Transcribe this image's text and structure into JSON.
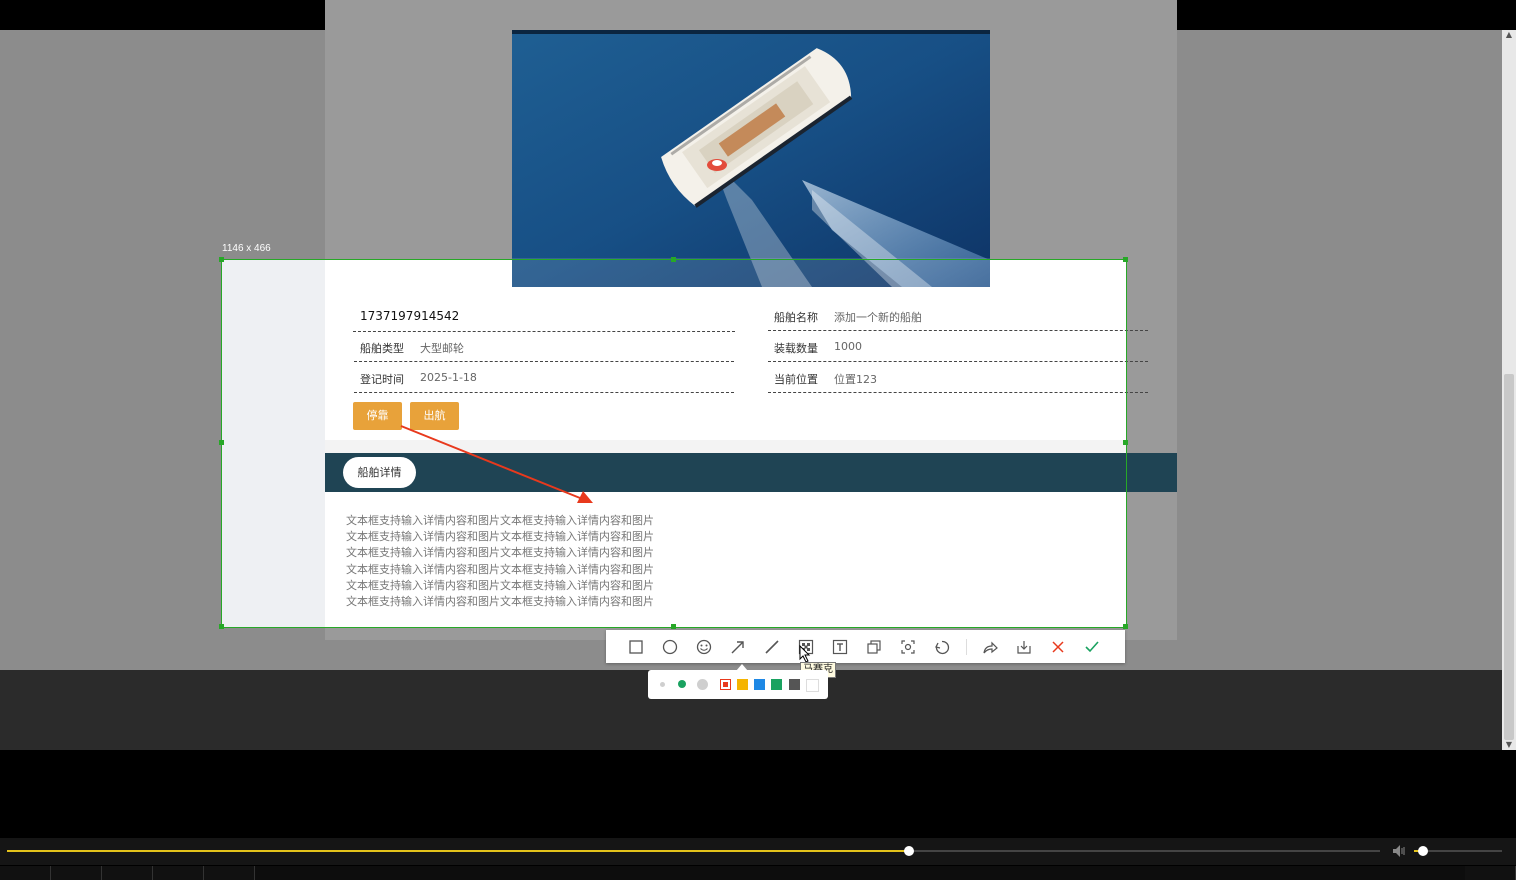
{
  "screenshot_tool": {
    "selection_size": "1146 x 466",
    "tooltip": "马赛克",
    "tools": [
      "rectangle-icon",
      "ellipse-icon",
      "emoji-icon",
      "arrow-icon",
      "line-icon",
      "mosaic-icon",
      "text-icon",
      "pin-icon",
      "ocr-icon",
      "undo-icon",
      "share-icon",
      "download-icon",
      "close-icon",
      "confirm-icon"
    ],
    "colors": [
      "#e8391d",
      "#f5b400",
      "#1e88e5",
      "#1aa260",
      "#555555",
      "#ffffff"
    ],
    "arrow_color": "#e8391d"
  },
  "ship": {
    "id": "1737197914542",
    "fields_left": [
      {
        "label": "船舶类型",
        "value": "大型邮轮"
      },
      {
        "label": "登记时间",
        "value": "2025-1-18"
      }
    ],
    "fields_right": [
      {
        "label": "船舶名称",
        "value": "添加一个新的船舶"
      },
      {
        "label": "装载数量",
        "value": "1000"
      },
      {
        "label": "当前位置",
        "value": "位置123"
      }
    ],
    "buttons": {
      "dock": "停靠",
      "depart": "出航"
    },
    "details_tab": "船舶详情",
    "description_lines": [
      "文本框支持输入详情内容和图片文本框支持输入详情内容和图片",
      "文本框支持输入详情内容和图片文本框支持输入详情内容和图片",
      "文本框支持输入详情内容和图片文本框支持输入详情内容和图片",
      "文本框支持输入详情内容和图片文本框支持输入详情内容和图片",
      "文本框支持输入详情内容和图片文本框支持输入详情内容和图片",
      "文本框支持输入详情内容和图片文本框支持输入详情内容和图片"
    ]
  },
  "player": {
    "progress": 0.6,
    "volume": 0.1
  }
}
